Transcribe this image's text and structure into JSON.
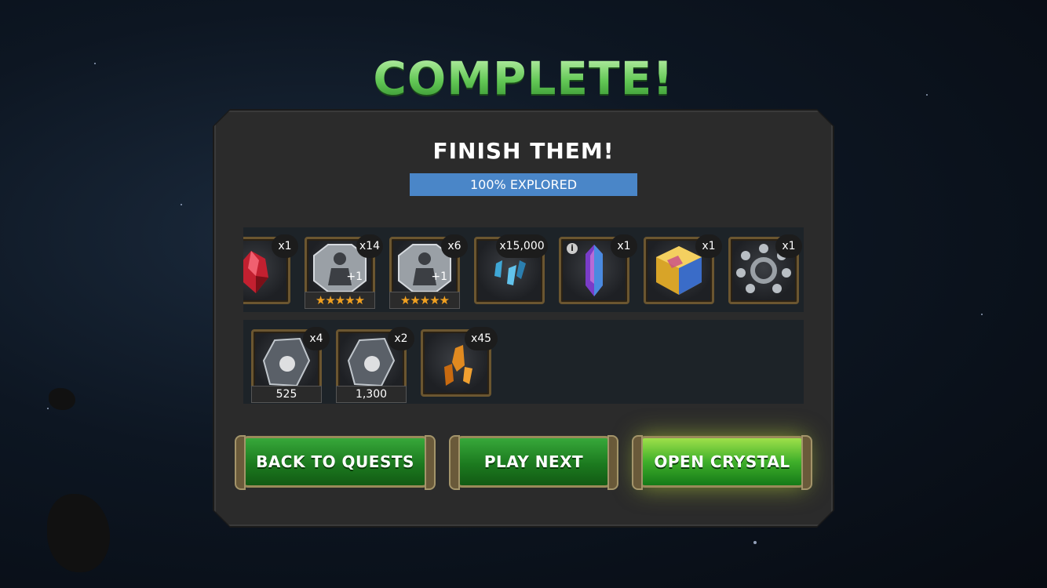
{
  "title": "COMPLETE!",
  "subtitle": "FINISH THEM!",
  "progress": {
    "label": "100% EXPLORED",
    "value": 1.0,
    "color": "#4a86c8"
  },
  "rewards_row1": [
    {
      "name": "red-crystal-shard-icon",
      "qty": "x1"
    },
    {
      "name": "silver-hero-token-icon",
      "qty": "x14",
      "stars": "★★★★★",
      "badge": "+1"
    },
    {
      "name": "silver-hero-token-icon",
      "qty": "x6",
      "stars": "★★★★★",
      "badge": "+1"
    },
    {
      "name": "blue-shards-icon",
      "qty": "x15,000"
    },
    {
      "name": "purple-crystal-icon",
      "qty": "x1",
      "info": "i"
    },
    {
      "name": "gold-cube-crystal-icon",
      "qty": "x1"
    },
    {
      "name": "catalyst-orb-icon",
      "qty": "x1"
    }
  ],
  "rewards_row2": [
    {
      "name": "iso-crystal-icon",
      "qty": "x4",
      "value": "525"
    },
    {
      "name": "iso-crystal-icon",
      "qty": "x2",
      "value": "1,300"
    },
    {
      "name": "gold-shards-icon",
      "qty": "x45"
    }
  ],
  "buttons": {
    "back": "BACK TO QUESTS",
    "play_next": "PLAY NEXT",
    "open_crystal": "OPEN CRYSTAL"
  },
  "colors": {
    "title_green": "#62c755",
    "button_green": "#1c7a1f",
    "star_gold": "#f0a020"
  }
}
